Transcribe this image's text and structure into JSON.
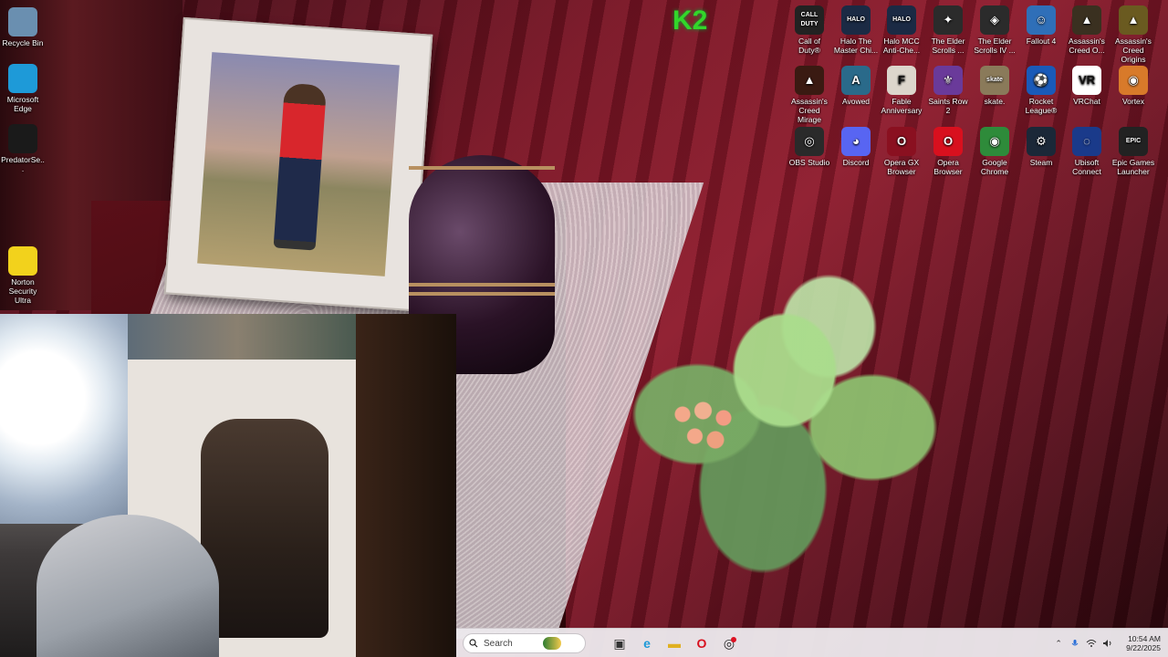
{
  "desktop": {
    "left_icons": [
      {
        "name": "recycle-bin-icon",
        "label": "Recycle Bin",
        "color": "#6a8fb0"
      },
      {
        "name": "edge-icon",
        "label": "Microsoft Edge",
        "color": "#1e9ad8"
      },
      {
        "name": "predator-sense-icon",
        "label": "PredatorSe...",
        "color": "#1a1a1a"
      },
      {
        "name": "norton-icon",
        "label": "Norton Security Ultra",
        "color": "#f2d21c"
      }
    ],
    "grid_icons": [
      {
        "name": "call-of-duty-icon",
        "label": "Call of Duty®",
        "color": "#222222",
        "glyph": "CALL DUTY"
      },
      {
        "name": "halo-mcc-master-chief-icon",
        "label": "Halo The Master Chi...",
        "color": "#1b2a44",
        "glyph": "HALO"
      },
      {
        "name": "halo-mcc-anniversary-icon",
        "label": "Halo MCC Anti-Che...",
        "color": "#1b2a44",
        "glyph": "HALO"
      },
      {
        "name": "elder-scrolls-online-icon",
        "label": "The Elder Scrolls ...",
        "color": "#2b2b2b",
        "glyph": "✦"
      },
      {
        "name": "elder-scrolls-oblivion-icon",
        "label": "The Elder Scrolls IV ...",
        "color": "#2b2b2b",
        "glyph": "◈"
      },
      {
        "name": "fallout-4-icon",
        "label": "Fallout 4",
        "color": "#2f6fb8",
        "glyph": "☺"
      },
      {
        "name": "assassins-creed-odyssey-icon",
        "label": "Assassin's Creed O...",
        "color": "#3a3020",
        "glyph": "▲"
      },
      {
        "name": "assassins-creed-origins-icon",
        "label": "Assassin's Creed Origins",
        "color": "#6a5a20",
        "glyph": "▲"
      },
      {
        "name": "assassins-creed-mirage-icon",
        "label": "Assassin's Creed Mirage",
        "color": "#3a1a12",
        "glyph": "▲"
      },
      {
        "name": "avowed-icon",
        "label": "Avowed",
        "color": "#2a6a8a",
        "glyph": "A"
      },
      {
        "name": "fable-anniversary-icon",
        "label": "Fable Anniversary",
        "color": "#dcd6cc",
        "glyph": "F"
      },
      {
        "name": "saints-row-2-icon",
        "label": "Saints Row 2",
        "color": "#6a3a9a",
        "glyph": "⚜"
      },
      {
        "name": "skate-icon",
        "label": "skate.",
        "color": "#8a7a5a",
        "glyph": "skate"
      },
      {
        "name": "rocket-league-icon",
        "label": "Rocket League®",
        "color": "#1a5ab8",
        "glyph": "⚽"
      },
      {
        "name": "vrchat-icon",
        "label": "VRChat",
        "color": "#ffffff",
        "glyph": "VR"
      },
      {
        "name": "vortex-icon",
        "label": "Vortex",
        "color": "#d87a2a",
        "glyph": "◉"
      },
      {
        "name": "obs-studio-icon",
        "label": "OBS Studio",
        "color": "#2a2a2a",
        "glyph": "◎"
      },
      {
        "name": "discord-icon",
        "label": "Discord",
        "color": "#5865f2",
        "glyph": "◕"
      },
      {
        "name": "opera-gx-icon",
        "label": "Opera GX Browser",
        "color": "#8a1020",
        "glyph": "O"
      },
      {
        "name": "opera-browser-icon",
        "label": "Opera Browser",
        "color": "#d8101e",
        "glyph": "O"
      },
      {
        "name": "google-chrome-icon",
        "label": "Google Chrome",
        "color": "#2e8b3a",
        "glyph": "◉"
      },
      {
        "name": "steam-icon",
        "label": "Steam",
        "color": "#1b2838",
        "glyph": "⚙"
      },
      {
        "name": "ubisoft-connect-icon",
        "label": "Ubisoft Connect",
        "color": "#1a3a8a",
        "glyph": "◌"
      },
      {
        "name": "epic-games-launcher-icon",
        "label": "Epic Games Launcher",
        "color": "#222222",
        "glyph": "EPIC"
      }
    ]
  },
  "taskbar": {
    "search_placeholder": "Search",
    "apps": [
      {
        "name": "task-view-icon",
        "glyph": "▣"
      },
      {
        "name": "edge-taskbar-icon",
        "glyph": "e"
      },
      {
        "name": "file-explorer-icon",
        "glyph": "▬"
      },
      {
        "name": "opera-taskbar-icon",
        "glyph": "O"
      },
      {
        "name": "obs-taskbar-icon",
        "glyph": "◎"
      }
    ],
    "clock_time": "10:54 AM",
    "clock_date": "9/22/2025"
  },
  "colors": {
    "taskbar_bg": "#ece8ec",
    "wallpaper_red": "#8e1a2c"
  }
}
